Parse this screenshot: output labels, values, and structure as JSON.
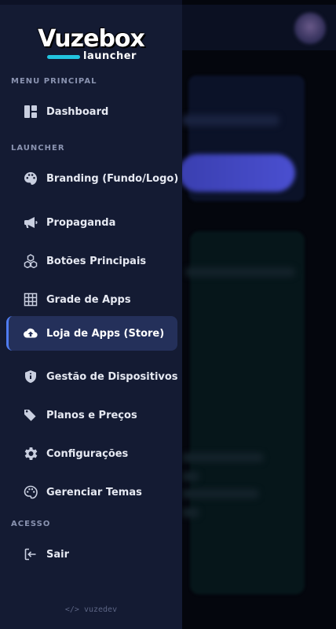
{
  "logo": {
    "main": "Vuzebox",
    "sub": "launcher"
  },
  "sections": {
    "main": "MENU PRINCIPAL",
    "launcher": "LAUNCHER",
    "access": "ACESSO"
  },
  "menu": {
    "dashboard": {
      "label": "Dashboard",
      "icon": "dashboard-icon"
    },
    "items": [
      {
        "label": "Branding (Fundo/Logo)",
        "icon": "palette-icon"
      },
      {
        "label": "Propaganda",
        "icon": "megaphone-icon"
      },
      {
        "label": "Botões Principais",
        "icon": "cubes-icon"
      },
      {
        "label": "Grade de Apps",
        "icon": "grid-icon"
      },
      {
        "label": "Loja de Apps (Store)",
        "icon": "cloud-upload-icon",
        "active": true
      },
      {
        "label": "Gestão de Dispositivos",
        "icon": "shield-icon"
      },
      {
        "label": "Planos e Preços",
        "icon": "tags-icon"
      },
      {
        "label": "Configurações",
        "icon": "gear-icon"
      },
      {
        "label": "Gerenciar Temas",
        "icon": "theme-palette-icon"
      }
    ],
    "logout": {
      "label": "Sair",
      "icon": "sign-out-icon"
    }
  },
  "footer": {
    "text": "</> vuzedev"
  },
  "colors": {
    "drawer_bg": "#141b33",
    "active_bg": "#24305a",
    "active_accent": "#4f7cf0",
    "logo_accent": "#22c5e0"
  }
}
